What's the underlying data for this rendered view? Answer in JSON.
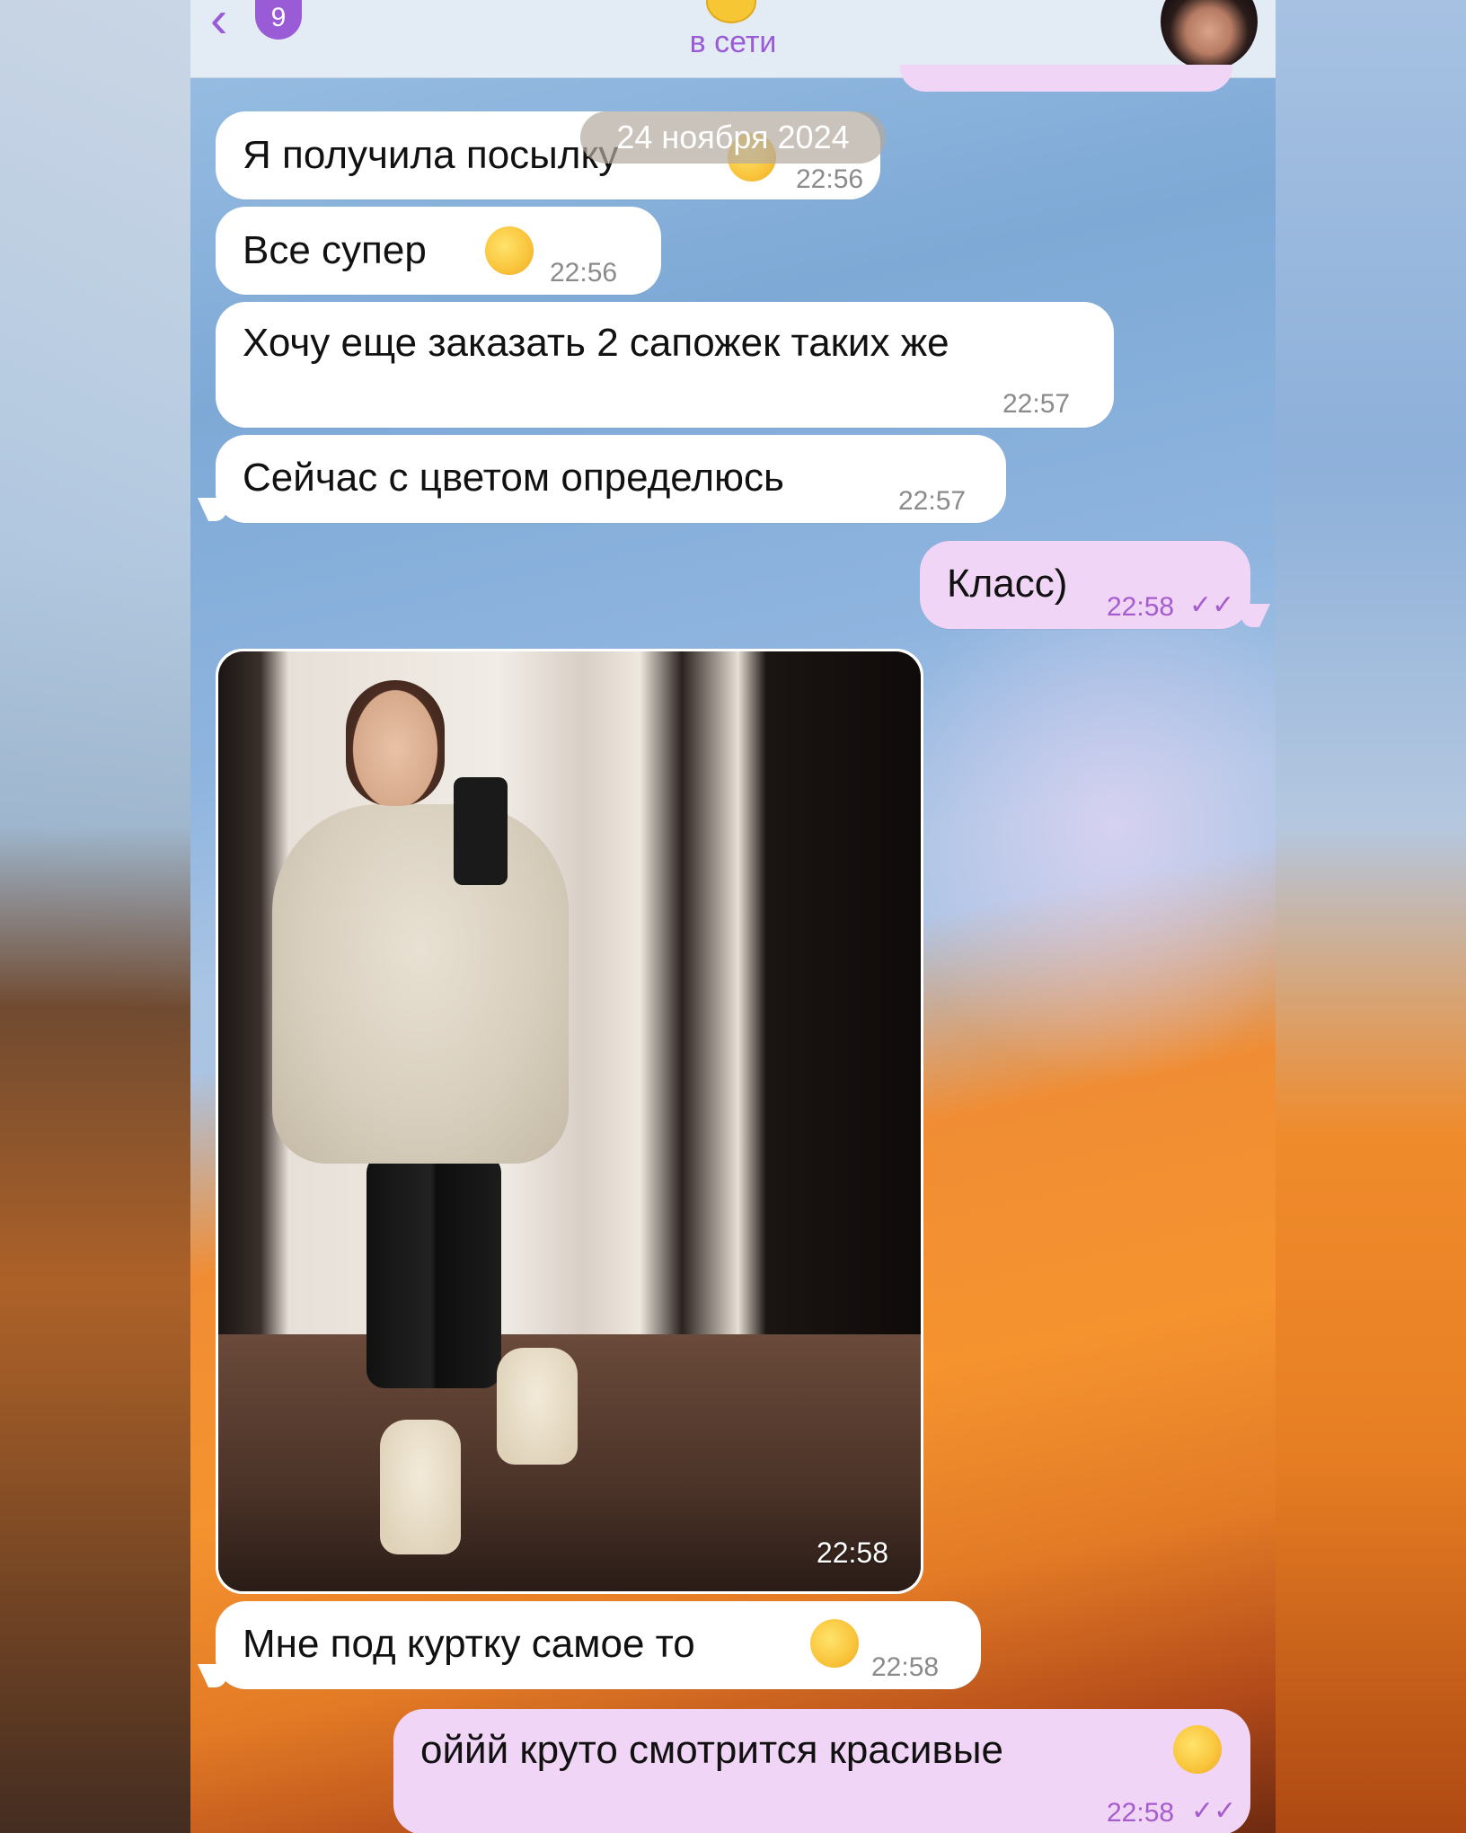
{
  "header": {
    "unread_count": "9",
    "status": "в сети"
  },
  "date_separator": "24 ноября 2024",
  "messages": [
    {
      "text": "Я получила посылку",
      "time": "22:56",
      "direction": "in",
      "emoji": "smiling-face-with-hearts"
    },
    {
      "text": "Все супер",
      "time": "22:56",
      "direction": "in",
      "emoji": "smiling-face-with-hearts"
    },
    {
      "text": "Хочу еще заказать 2 сапожек таких же",
      "time": "22:57",
      "direction": "in"
    },
    {
      "text": "Сейчас с цветом определюсь",
      "time": "22:57",
      "direction": "in"
    },
    {
      "text": "Класс)",
      "time": "22:58",
      "direction": "out",
      "read": true
    },
    {
      "type": "photo",
      "time": "22:58",
      "direction": "in"
    },
    {
      "text": "Мне под куртку самое то",
      "time": "22:58",
      "direction": "in",
      "emoji": "smiling-face-with-hearts"
    },
    {
      "text": "оййй круто смотрится красивые",
      "time": "22:58",
      "direction": "out",
      "read": true,
      "emoji": "heart-eyes"
    }
  ],
  "colors": {
    "accent": "#9a5bd6",
    "outgoing_bubble": "#f1d5f6",
    "incoming_bubble": "#ffffff"
  }
}
